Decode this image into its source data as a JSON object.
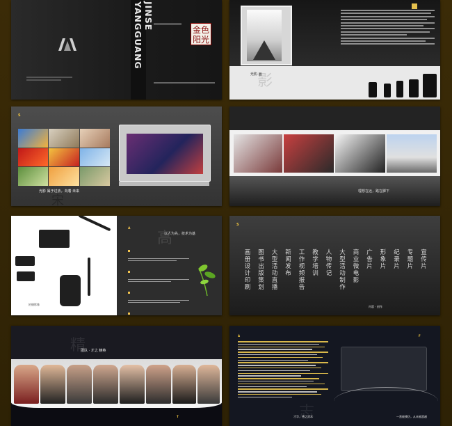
{
  "spread1": {
    "spine_text": "JINSE YANGGUANG",
    "logo_line1": "金色",
    "logo_line2": "阳光"
  },
  "spread2": {
    "title": "光影·画"
  },
  "spread3": {
    "caption": "光影 属于过去，向着 未来"
  },
  "spread4": {
    "caption": "理想在远，路在脚下"
  },
  "spread5": {
    "tag": "以人为先，技术为基",
    "caption": "拍摄影像"
  },
  "spread6": {
    "columns": [
      "宣传片",
      "专题片",
      "纪录片",
      "形象片",
      "广告片",
      "商业微电影",
      "大型活动制作",
      "人物传记",
      "教学培训",
      "工作视频报告",
      "新闻发布",
      "大型活动直播",
      "图书出版策划",
      "画册设计印刷"
    ],
    "caption": "内容 · 创作"
  },
  "spread7": {
    "title": "团队 · 才之 精英"
  },
  "spread8": {
    "caption_left": "才华，德之资本",
    "caption_right": "一直被模仿，从未被超越"
  }
}
